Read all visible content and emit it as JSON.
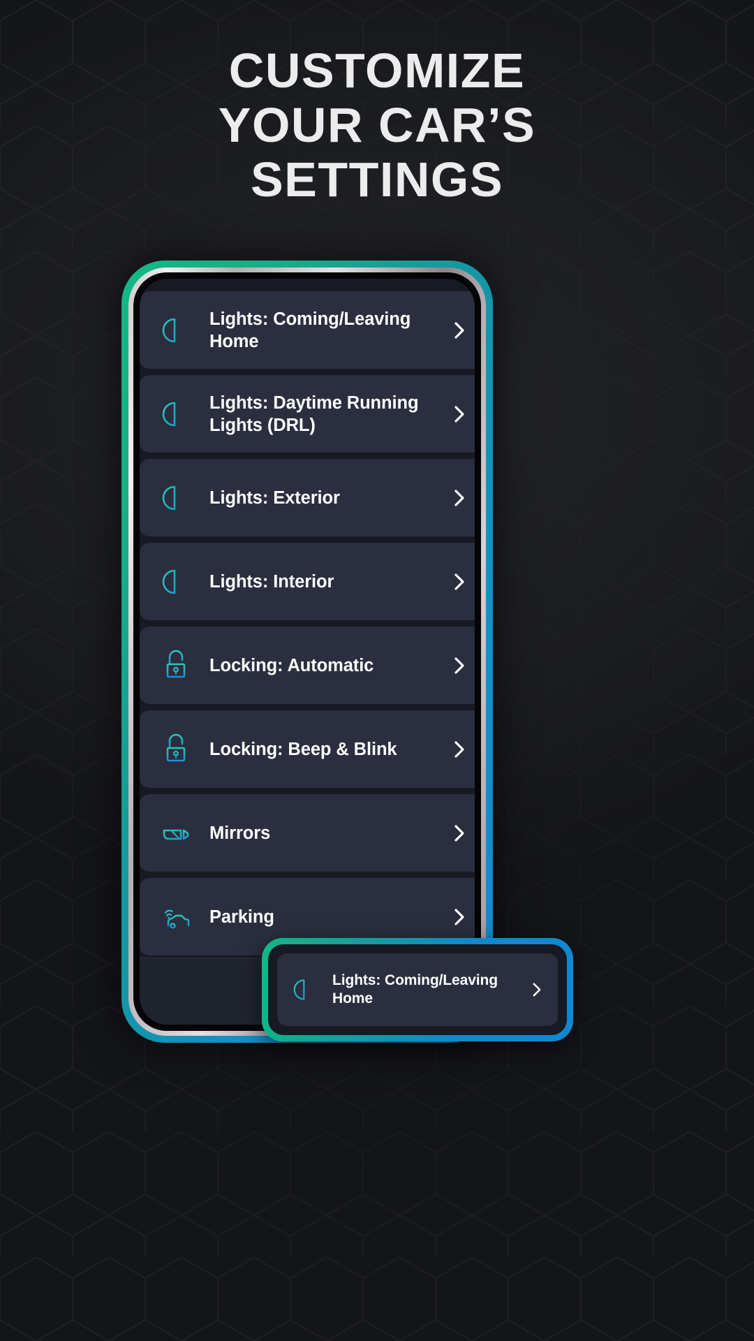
{
  "headline": {
    "line1": "CUSTOMIZE",
    "line2": "YOUR CAR’S",
    "line3": "SETTINGS"
  },
  "colors": {
    "background": "#1b1c20",
    "card": "#2a2e3e",
    "screen": "#171a23",
    "accent_green": "#12b886",
    "accent_blue": "#0d89d4",
    "icon_teal": "#2ec4b6",
    "icon_blue": "#1f8fd6",
    "text_primary": "#ffffff",
    "headline_text": "#ececec",
    "nav_home": "#3f8ecf"
  },
  "phone": {
    "settings_list": [
      {
        "label": "Lights: Coming/Leaving Home",
        "icon": "headlight-icon",
        "chevron": "chevron-right-icon"
      },
      {
        "label": "Lights: Daytime Running Lights (DRL)",
        "icon": "headlight-icon",
        "chevron": "chevron-right-icon"
      },
      {
        "label": "Lights: Exterior",
        "icon": "headlight-icon",
        "chevron": "chevron-right-icon"
      },
      {
        "label": "Lights: Interior",
        "icon": "headlight-icon",
        "chevron": "chevron-right-icon"
      },
      {
        "label": "Locking: Automatic",
        "icon": "padlock-icon",
        "chevron": "chevron-right-icon"
      },
      {
        "label": "Locking: Beep & Blink",
        "icon": "padlock-icon",
        "chevron": "chevron-right-icon"
      },
      {
        "label": "Mirrors",
        "icon": "side-mirror-icon",
        "chevron": "chevron-right-icon"
      },
      {
        "label": "Parking",
        "icon": "parking-sensor-icon",
        "chevron": "chevron-right-icon"
      }
    ],
    "navbar": {
      "home_icon": "home-icon"
    }
  },
  "callout": {
    "label": "Lights: Coming/Leaving Home",
    "icon": "headlight-icon",
    "chevron": "chevron-right-icon"
  }
}
